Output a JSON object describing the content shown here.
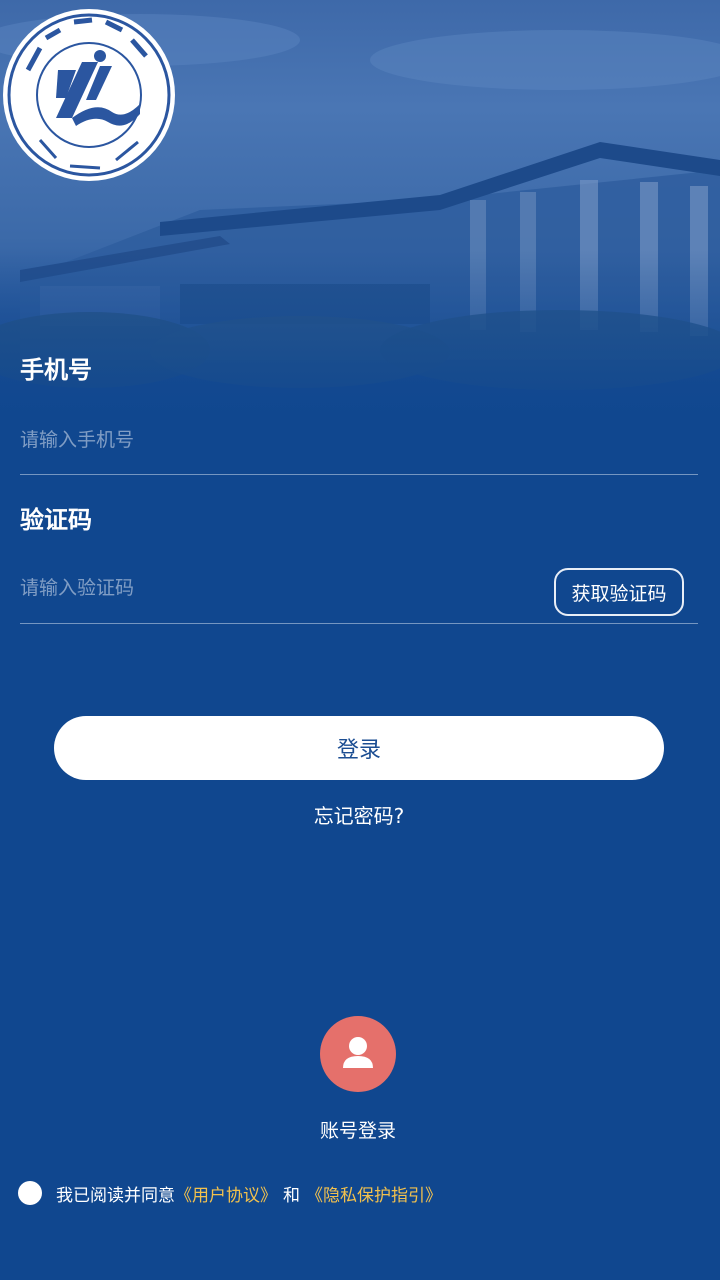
{
  "form": {
    "phone_label": "手机号",
    "phone_placeholder": "请输入手机号",
    "code_label": "验证码",
    "code_placeholder": "请输入验证码",
    "get_code_label": "获取验证码"
  },
  "actions": {
    "login_label": "登录",
    "forgot_label": "忘记密码?",
    "account_login_label": "账号登录"
  },
  "agreement": {
    "prefix": "我已阅读并同意",
    "user_agreement": "《用户协议》",
    "and": "和",
    "privacy": "《隐私保护指引》"
  },
  "colors": {
    "background": "#10478f",
    "button_text": "#1b4d92",
    "account_icon_bg": "#e5706b",
    "link": "#f2c14e"
  },
  "icons": {
    "logo": "university-seal-logo",
    "account": "user-icon"
  }
}
